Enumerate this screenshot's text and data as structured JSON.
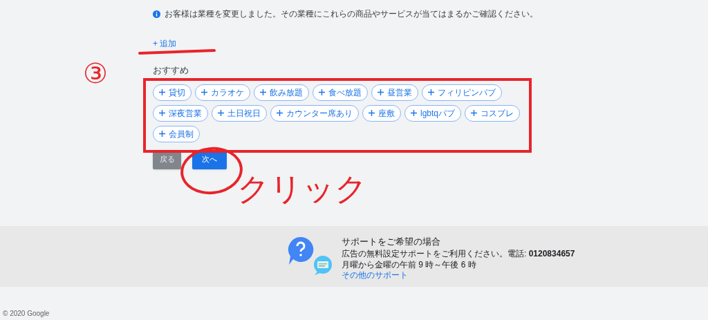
{
  "info": {
    "text": "お客様は業種を変更しました。その業種にこれらの商品やサービスが当てはまるかご確認ください。"
  },
  "add_link": "+ 追加",
  "recommended": {
    "title": "おすすめ",
    "chips": [
      {
        "label": "貸切"
      },
      {
        "label": "カラオケ"
      },
      {
        "label": "飲み放題"
      },
      {
        "label": "食べ放題"
      },
      {
        "label": "昼営業"
      },
      {
        "label": "フィリピンパブ"
      },
      {
        "label": "深夜営業"
      },
      {
        "label": "土日祝日"
      },
      {
        "label": "カウンター席あり"
      },
      {
        "label": "座敷"
      },
      {
        "label": "lgbtqパブ"
      },
      {
        "label": "コスプレ"
      },
      {
        "label": "会員制"
      }
    ]
  },
  "buttons": [
    {
      "label": "戻る",
      "kind": "secondary"
    },
    {
      "label": "次へ",
      "kind": "primary"
    }
  ],
  "support": {
    "title": "サポートをご希望の場合",
    "lines": [
      "広告の無料設定サポートをご利用ください。電話: **0120834657**",
      "月曜から金曜の午前 9 時～午後 6 時"
    ],
    "link": "その他のサポート"
  },
  "copyright": "© 2020 Google",
  "annotations": {
    "step_mark": "③",
    "click_label": "クリック"
  }
}
